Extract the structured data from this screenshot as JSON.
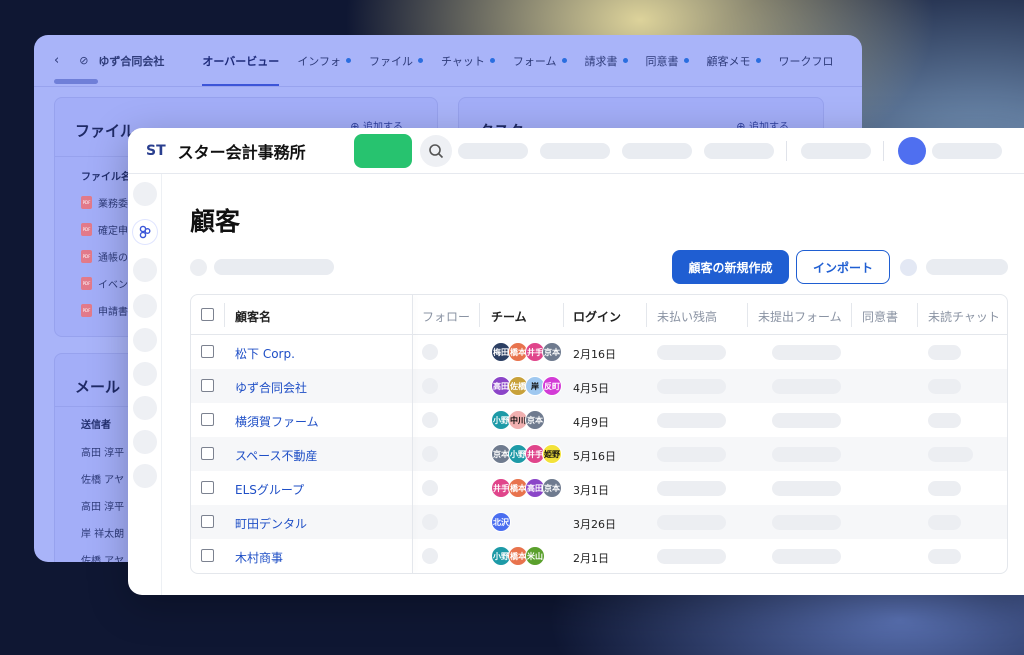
{
  "back": {
    "company": "ゆず合同会社",
    "tabs": [
      {
        "label": "オーバービュー",
        "dot": false,
        "active": true
      },
      {
        "label": "インフォ",
        "dot": true
      },
      {
        "label": "ファイル",
        "dot": true
      },
      {
        "label": "チャット",
        "dot": true
      },
      {
        "label": "フォーム",
        "dot": true
      },
      {
        "label": "請求書",
        "dot": true
      },
      {
        "label": "同意書",
        "dot": true
      },
      {
        "label": "顧客メモ",
        "dot": true
      },
      {
        "label": "ワークフロ",
        "dot": false
      }
    ],
    "files_card": {
      "title": "ファイル",
      "add_label": "追加する",
      "col_label": "ファイル名",
      "rows": [
        "業務委",
        "確定申",
        "通帳の",
        "イベン",
        "申請書"
      ]
    },
    "task_card": {
      "title": "タスク",
      "add_label": "追加する"
    },
    "mail_card": {
      "title": "メール",
      "col_label": "送信者",
      "rows": [
        "高田 淳平",
        "佐橋 アヤ",
        "高田 淳平",
        "岸 祥太朗",
        "佐橋 アヤ"
      ]
    }
  },
  "front": {
    "logo": "ST",
    "brand": "スター会計事務所",
    "page_title": "顧客",
    "new_client_label": "顧客の新規作成",
    "import_label": "インポート",
    "columns": [
      "顧客名",
      "フォロー",
      "チーム",
      "ログイン",
      "未払い残高",
      "未提出フォーム",
      "同意書",
      "未読チャット"
    ],
    "rows": [
      {
        "name": "松下 Corp.",
        "login": "2月16日",
        "team": [
          {
            "t": "梅田",
            "c": "#2c3f63"
          },
          {
            "t": "橋本",
            "c": "#e8734d"
          },
          {
            "t": "井手",
            "c": "#e0458b"
          },
          {
            "t": "京本",
            "c": "#6f7b8f"
          }
        ]
      },
      {
        "name": "ゆず合同会社",
        "login": "4月5日",
        "team": [
          {
            "t": "高田",
            "c": "#8b45c8"
          },
          {
            "t": "佐橋",
            "c": "#c8a13a"
          },
          {
            "t": "岸",
            "c": "#9fc8f0"
          },
          {
            "t": "反町",
            "c": "#d33bd6"
          }
        ]
      },
      {
        "name": "横須賀ファーム",
        "login": "4月9日",
        "team": [
          {
            "t": "小野",
            "c": "#1d9aa7"
          },
          {
            "t": "中川",
            "c": "#f1b0b0"
          },
          {
            "t": "京本",
            "c": "#6f7b8f"
          }
        ]
      },
      {
        "name": "スペース不動産",
        "login": "5月16日",
        "team": [
          {
            "t": "京本",
            "c": "#6f7b8f"
          },
          {
            "t": "小野",
            "c": "#1d9aa7"
          },
          {
            "t": "井手",
            "c": "#e0458b"
          },
          {
            "t": "姫野",
            "c": "#f3e23a"
          }
        ]
      },
      {
        "name": "ELSグループ",
        "login": "3月1日",
        "team": [
          {
            "t": "井手",
            "c": "#e0458b"
          },
          {
            "t": "橋本",
            "c": "#e8734d"
          },
          {
            "t": "高田",
            "c": "#8b45c8"
          },
          {
            "t": "京本",
            "c": "#6f7b8f"
          }
        ]
      },
      {
        "name": "町田デンタル",
        "login": "3月26日",
        "team": [
          {
            "t": "北沢",
            "c": "#4a6ef0"
          }
        ]
      },
      {
        "name": "木村商事",
        "login": "2月1日",
        "team": [
          {
            "t": "小野",
            "c": "#1d9aa7"
          },
          {
            "t": "橋本",
            "c": "#e8734d"
          },
          {
            "t": "米山",
            "c": "#5aa02c"
          }
        ]
      }
    ]
  }
}
